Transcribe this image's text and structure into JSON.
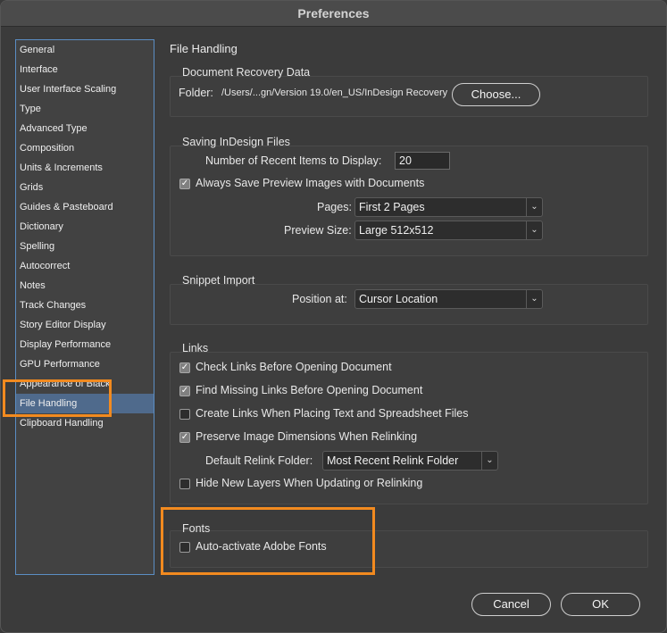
{
  "window": {
    "title": "Preferences"
  },
  "sidebar": {
    "items": [
      {
        "label": "General"
      },
      {
        "label": "Interface"
      },
      {
        "label": "User Interface Scaling"
      },
      {
        "label": "Type"
      },
      {
        "label": "Advanced Type"
      },
      {
        "label": "Composition"
      },
      {
        "label": "Units & Increments"
      },
      {
        "label": "Grids"
      },
      {
        "label": "Guides & Pasteboard"
      },
      {
        "label": "Dictionary"
      },
      {
        "label": "Spelling"
      },
      {
        "label": "Autocorrect"
      },
      {
        "label": "Notes"
      },
      {
        "label": "Track Changes"
      },
      {
        "label": "Story Editor Display"
      },
      {
        "label": "Display Performance"
      },
      {
        "label": "GPU Performance"
      },
      {
        "label": "Appearance of Black"
      },
      {
        "label": "File Handling"
      },
      {
        "label": "Clipboard Handling"
      }
    ],
    "selected": "File Handling"
  },
  "main": {
    "title": "File Handling",
    "recovery": {
      "title": "Document Recovery Data",
      "folder_label": "Folder:",
      "folder_path": "/Users/...gn/Version 19.0/en_US/InDesign Recovery",
      "choose_label": "Choose..."
    },
    "saving": {
      "title": "Saving InDesign Files",
      "recent_label": "Number of Recent Items to Display:",
      "recent_value": "20",
      "preview_label": "Always Save Preview Images with Documents",
      "preview_checked": true,
      "pages_label": "Pages:",
      "pages_value": "First 2 Pages",
      "size_label": "Preview Size:",
      "size_value": "Large 512x512"
    },
    "snippet": {
      "title": "Snippet Import",
      "position_label": "Position at:",
      "position_value": "Cursor Location"
    },
    "links": {
      "title": "Links",
      "check_links": "Check Links Before Opening Document",
      "find_missing": "Find Missing Links Before Opening Document",
      "create_links": "Create Links When Placing Text and Spreadsheet Files",
      "preserve_dims": "Preserve Image Dimensions When Relinking",
      "relink_label": "Default Relink Folder:",
      "relink_value": "Most Recent Relink Folder",
      "hide_layers": "Hide New Layers When Updating or Relinking"
    },
    "fonts": {
      "title": "Fonts",
      "auto_activate": "Auto-activate Adobe Fonts"
    }
  },
  "footer": {
    "cancel_label": "Cancel",
    "ok_label": "OK"
  },
  "colors": {
    "highlight": "#f28a1f",
    "selected": "#4f6a8c",
    "sidebar_border": "#5b8ec4"
  },
  "icons": {
    "checkbox_checked": "check-icon",
    "dropdown": "chevron-down-icon"
  }
}
